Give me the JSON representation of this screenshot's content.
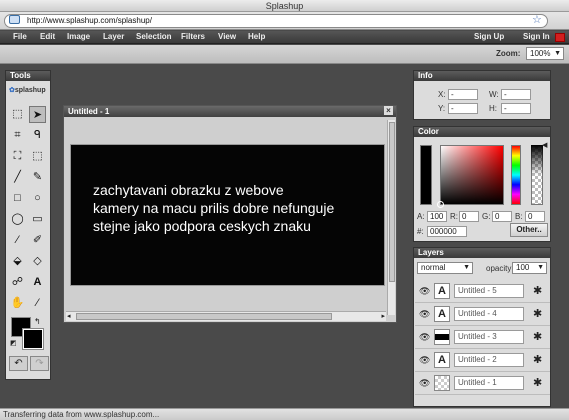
{
  "window": {
    "title": "Splashup"
  },
  "browser": {
    "url": "http://www.splashup.com/splashup/"
  },
  "menu": {
    "items": [
      "File",
      "Edit",
      "Image",
      "Layer",
      "Selection",
      "Filters",
      "View",
      "Help"
    ],
    "sign_up": "Sign Up",
    "sign_in": "Sign In"
  },
  "zoom": {
    "label": "Zoom:",
    "value": "100%"
  },
  "tools": {
    "title": "Tools",
    "logo": "splashup"
  },
  "document": {
    "title": "Untitled - 1",
    "close": "×",
    "canvas_text": "zachytavani obrazku z webove\nkamery na macu prilis dobre nefunguje\nstejne jako podpora ceskych znaku"
  },
  "info": {
    "title": "Info",
    "x_label": "X:",
    "y_label": "Y:",
    "w_label": "W:",
    "h_label": "H:",
    "x": "-",
    "y": "-",
    "w": "-",
    "h": "-"
  },
  "color": {
    "title": "Color",
    "a_label": "A:",
    "a": "100",
    "r_label": "R:",
    "r": "0",
    "g_label": "G:",
    "g": "0",
    "b_label": "B:",
    "b": "0",
    "hex_label": "#:",
    "hex": "000000",
    "other": "Other..",
    "current": "#000000"
  },
  "layers": {
    "title": "Layers",
    "blend_mode": "normal",
    "opacity_label": "opacity:",
    "opacity": "100",
    "items": [
      {
        "name": "Untitled - 5",
        "thumb": "A"
      },
      {
        "name": "Untitled - 4",
        "thumb": "A"
      },
      {
        "name": "Untitled - 3",
        "thumb": ""
      },
      {
        "name": "Untitled - 2",
        "thumb": "A"
      },
      {
        "name": "Untitled - 1",
        "thumb": ""
      }
    ]
  },
  "status": {
    "text": "Transferring data from www.splashup.com..."
  }
}
